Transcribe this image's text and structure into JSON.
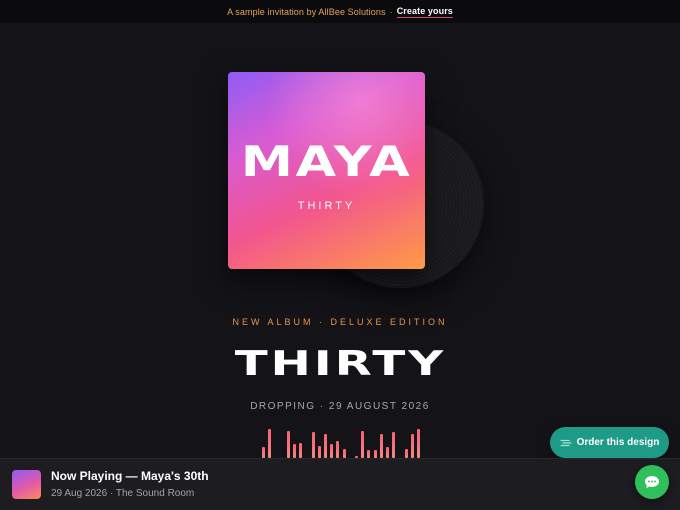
{
  "topbar": {
    "promo": "A sample invitation by AllBee Solutions",
    "separator": "·",
    "cta": "Create yours"
  },
  "cover": {
    "name": "MAYA",
    "subtitle": "THIRTY",
    "gradient": [
      "#8f5cf5",
      "#d85bd3",
      "#f2558f",
      "#ff9b45"
    ]
  },
  "hero": {
    "eyebrow": "NEW ALBUM · DELUXE EDITION",
    "headline": "THIRTY",
    "date": "DROPPING · 29 AUGUST 2026"
  },
  "equalizer": {
    "levels": [
      0.35,
      0.95,
      0.0,
      0.0,
      0.9,
      0.45,
      0.5,
      0.0,
      0.85,
      0.4,
      0.8,
      0.45,
      0.55,
      0.3,
      0.0,
      0.05,
      0.9,
      0.25,
      0.25,
      0.8,
      0.35,
      0.85,
      0.0,
      0.3,
      0.8,
      0.95
    ],
    "color": "#ff5f6d"
  },
  "order_button": {
    "label": "Order this design",
    "icon": "palette-icon",
    "color": "#1e9b86"
  },
  "player": {
    "title": "Now Playing — Maya's 30th",
    "meta": "29 Aug 2026 · The Sound Room"
  },
  "chat_button": {
    "icon": "chat-bubble-icon",
    "color": "#2ec05b"
  }
}
